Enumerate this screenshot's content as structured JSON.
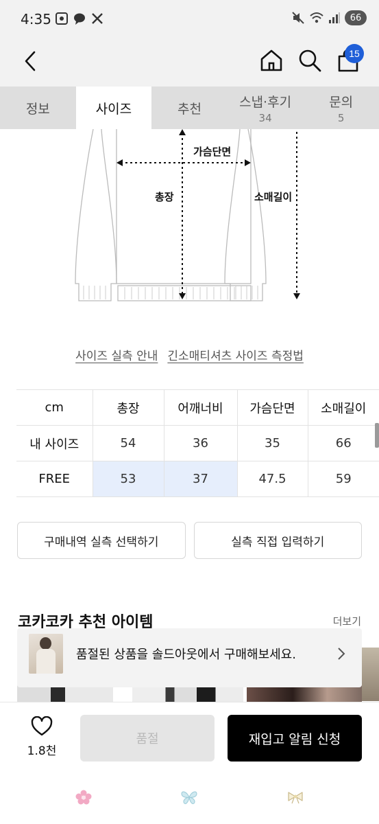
{
  "status": {
    "time": "4:35",
    "battery": "66"
  },
  "header": {
    "cart_count": "15"
  },
  "tabs": [
    {
      "label": "정보",
      "count": ""
    },
    {
      "label": "사이즈",
      "count": ""
    },
    {
      "label": "추천",
      "count": ""
    },
    {
      "label": "스냅·후기",
      "count": "34"
    },
    {
      "label": "문의",
      "count": "5"
    }
  ],
  "diagram": {
    "chest": "가슴단면",
    "length": "총장",
    "sleeve": "소매길이"
  },
  "links": {
    "guide": "사이즈 실측 안내",
    "method": "긴소매티셔츠 사이즈 측정법"
  },
  "size_table": {
    "headers": [
      "cm",
      "총장",
      "어깨너비",
      "가슴단면",
      "소매길이"
    ],
    "rows": [
      {
        "label": "내 사이즈",
        "values": [
          "54",
          "36",
          "35",
          "66"
        ]
      },
      {
        "label": "FREE",
        "values": [
          "53",
          "37",
          "47.5",
          "59"
        ]
      }
    ]
  },
  "buttons": {
    "history": "구매내역 실측 선택하기",
    "manual": "실측 직접 입력하기"
  },
  "recommend": {
    "title": "코카코카 추천 아이템",
    "more": "더보기"
  },
  "toast": {
    "message": "품절된 상품을 솔드아웃에서 구매해보세요."
  },
  "bottom": {
    "likes": "1.8천",
    "soldout": "품절",
    "restock": "재입고 알림 신청"
  },
  "colors": {
    "accent": "#1f5fd8",
    "highlight": "#e6eefc"
  }
}
